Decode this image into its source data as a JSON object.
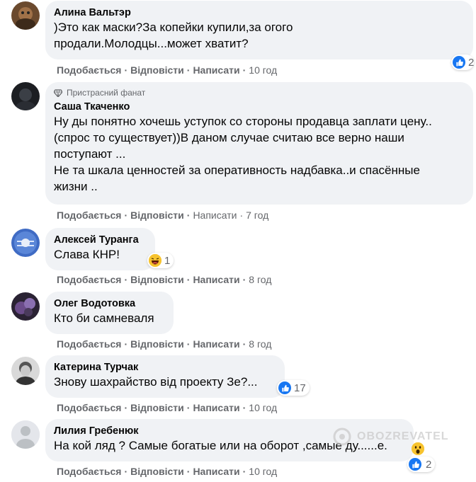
{
  "comments": [
    {
      "author": "Алина Вальтэр",
      "text": ")Это как маски?За копейки купили,за огого\nпродали.Молодцы...может хватит?",
      "actions": {
        "like": "Подобається",
        "reply": "Відповісти",
        "write": "Написати",
        "time": "10 год"
      },
      "reaction": {
        "type": "like",
        "count": "2"
      }
    },
    {
      "badge": "Пристрасний фанат",
      "author": "Саша Ткаченко",
      "text": "Ну ды понятно хочешь уступок со стороны продавца заплати цену..\n(спрос то существует))В даном случае считаю все верно наши\nпоступают ...\nНе та шкала ценностей за оперативность надбавка..и спасённые\nжизни ..",
      "actions": {
        "like": "Подобається",
        "reply": "Відповісти",
        "write": "Написати",
        "time": "7 год"
      }
    },
    {
      "author": "Алексей Туранга",
      "text": "Слава КНР!",
      "actions": {
        "like": "Подобається",
        "reply": "Відповісти",
        "write": "Написати",
        "time": "8 год"
      },
      "reaction": {
        "type": "haha",
        "count": "1"
      }
    },
    {
      "author": "Олег Водотовка",
      "text": "Кто би самневаля",
      "actions": {
        "like": "Подобається",
        "reply": "Відповісти",
        "write": "Написати",
        "time": "8 год"
      }
    },
    {
      "author": "Катерина Турчак",
      "text": "Знову шахрайство від проекту Зе?...",
      "actions": {
        "like": "Подобається",
        "reply": "Відповісти",
        "write": "Написати",
        "time": "10 год"
      },
      "reaction": {
        "type": "like",
        "count": "17"
      }
    },
    {
      "author": "Лилия Гребенюк",
      "text": "На кой ляд ? Самые богатые или на оборот ,самые ду......е.",
      "actions": {
        "like": "Подобається",
        "reply": "Відповісти",
        "write": "Написати",
        "time": "10 год"
      },
      "reaction": {
        "type": "like+wow",
        "count": "2"
      }
    }
  ],
  "watermark": "OBOZREVATEL",
  "colors": {
    "bubble": "#f0f2f5",
    "meta": "#65676b",
    "like": "#1877f2"
  }
}
